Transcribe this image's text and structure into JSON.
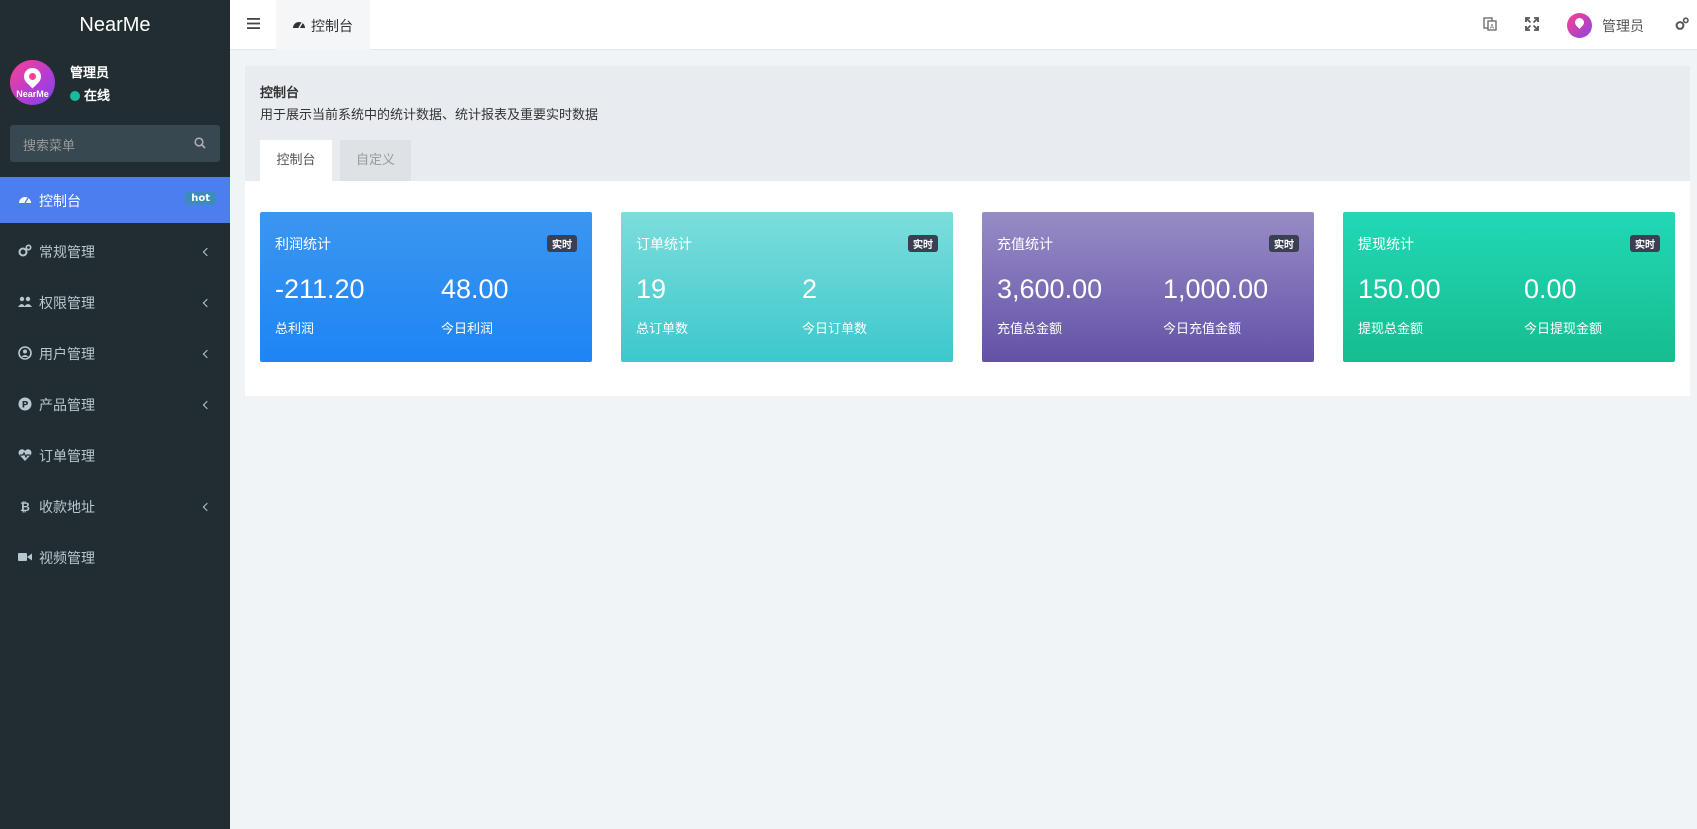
{
  "app": {
    "brand": "NearMe"
  },
  "user": {
    "name": "管理员",
    "status": "在线",
    "avatar_text": "NearMe"
  },
  "sidebar": {
    "search_placeholder": "搜索菜单",
    "items": [
      {
        "label": "控制台",
        "icon": "dashboard-icon",
        "badge": "hot",
        "active": true
      },
      {
        "label": "常规管理",
        "icon": "cogs-icon",
        "has_children": true
      },
      {
        "label": "权限管理",
        "icon": "group-icon",
        "has_children": true
      },
      {
        "label": "用户管理",
        "icon": "user-circle-icon",
        "has_children": true
      },
      {
        "label": "产品管理",
        "icon": "product-p-icon",
        "has_children": true
      },
      {
        "label": "订单管理",
        "icon": "heartbeat-icon",
        "has_children": false
      },
      {
        "label": "收款地址",
        "icon": "bitcoin-icon",
        "has_children": true
      },
      {
        "label": "视频管理",
        "icon": "video-camera-icon",
        "has_children": false
      }
    ]
  },
  "navbar": {
    "tab_label": "控制台",
    "tab_icon": "dashboard-icon",
    "right_icons": [
      "language-icon",
      "fullscreen-icon",
      "settings-icon"
    ],
    "user_name": "管理员"
  },
  "content": {
    "title": "控制台",
    "description": "用于展示当前系统中的统计数据、统计报表及重要实时数据",
    "tabs": [
      {
        "label": "控制台",
        "active": true
      },
      {
        "label": "自定义",
        "active": false
      }
    ]
  },
  "cards": [
    {
      "title": "利润统计",
      "tag": "实时",
      "value1": "-211.20",
      "label1": "总利润",
      "value2": "48.00",
      "label2": "今日利润"
    },
    {
      "title": "订单统计",
      "tag": "实时",
      "value1": "19",
      "label1": "总订单数",
      "value2": "2",
      "label2": "今日订单数"
    },
    {
      "title": "充值统计",
      "tag": "实时",
      "value1": "3,600.00",
      "label1": "充值总金额",
      "value2": "1,000.00",
      "label2": "今日充值金额"
    },
    {
      "title": "提现统计",
      "tag": "实时",
      "value1": "150.00",
      "label1": "提现总金额",
      "value2": "0.00",
      "label2": "今日提现金额"
    }
  ],
  "colors": {
    "sidebar_bg": "#222d32",
    "active_menu": "#4c7ef0",
    "card_profit": "#1d85f4",
    "card_orders": "#3cc8cc",
    "card_recharge": "#6451a7",
    "card_withdraw": "#16bd8f"
  }
}
